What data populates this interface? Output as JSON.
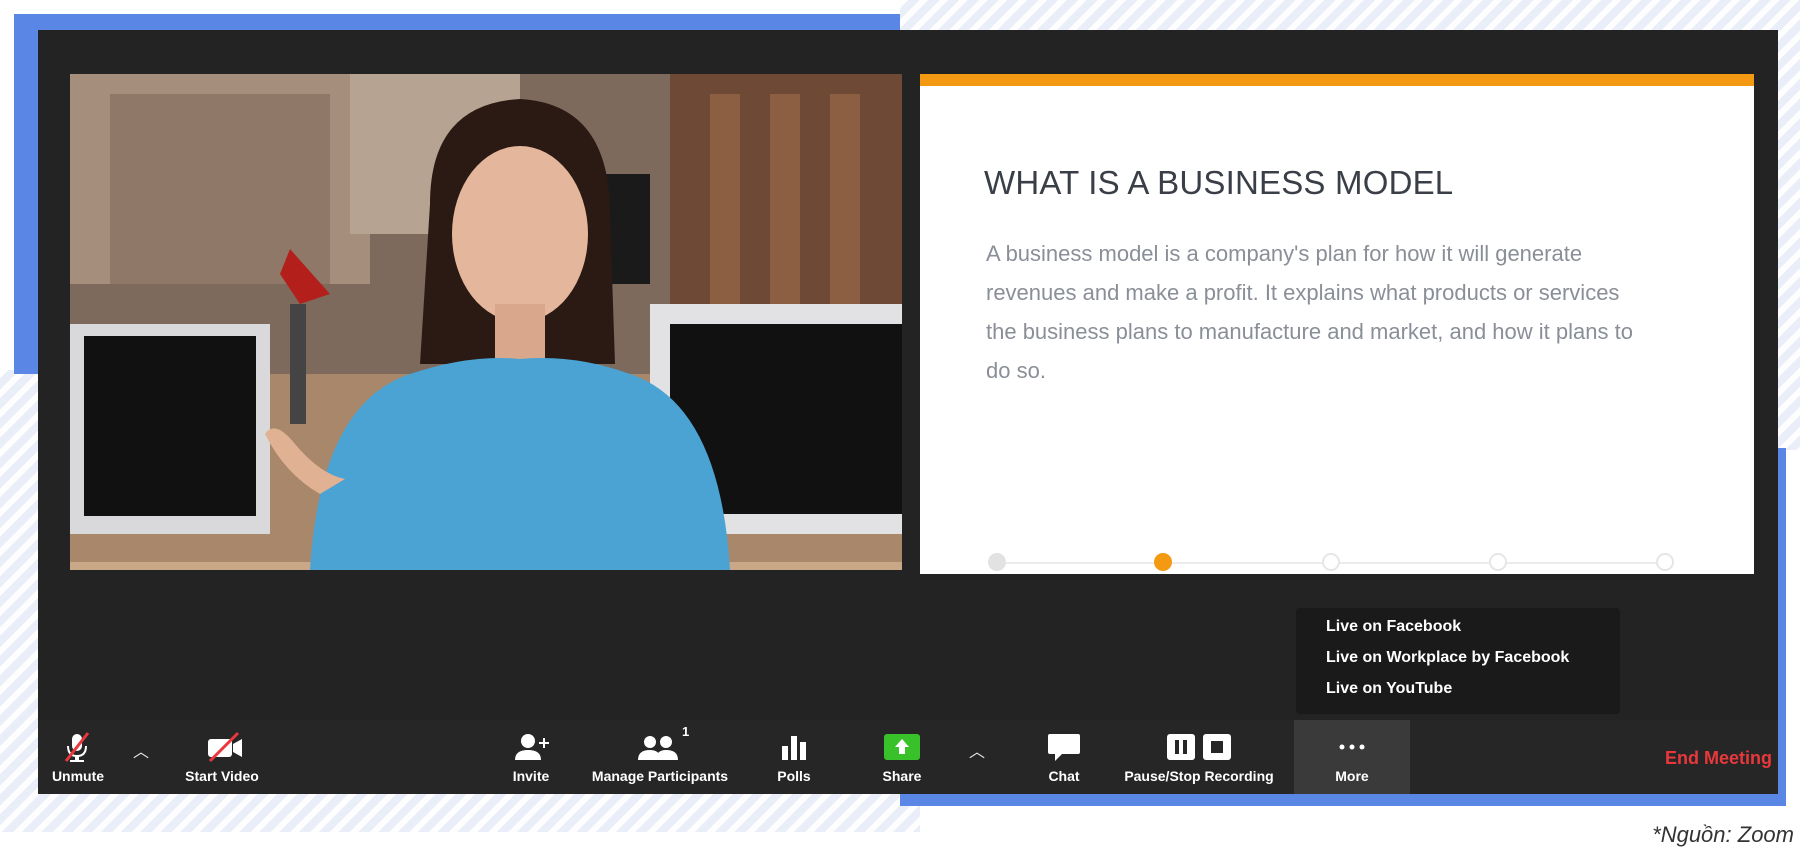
{
  "slide": {
    "title": "WHAT IS A BUSINESS MODEL",
    "body": "A business model is a company's plan for how it will generate revenues and make a profit. It explains what products or services the business plans to manufacture and market, and how it plans to do so.",
    "progress_steps": 5,
    "current_step": 2,
    "accent_color": "#f39a12"
  },
  "more_menu": {
    "items": [
      "Live on Facebook",
      "Live on Workplace by Facebook",
      "Live on YouTube"
    ]
  },
  "toolbar": {
    "unmute_label": "Unmute",
    "start_video_label": "Start Video",
    "invite_label": "Invite",
    "manage_participants_label": "Manage Participants",
    "participant_count": "1",
    "polls_label": "Polls",
    "share_label": "Share",
    "chat_label": "Chat",
    "recording_label": "Pause/Stop Recording",
    "more_label": "More",
    "end_meeting_label": "End Meeting",
    "share_color": "#39c12a",
    "end_color": "#e8383b"
  },
  "caption": "*Nguồn: Zoom"
}
